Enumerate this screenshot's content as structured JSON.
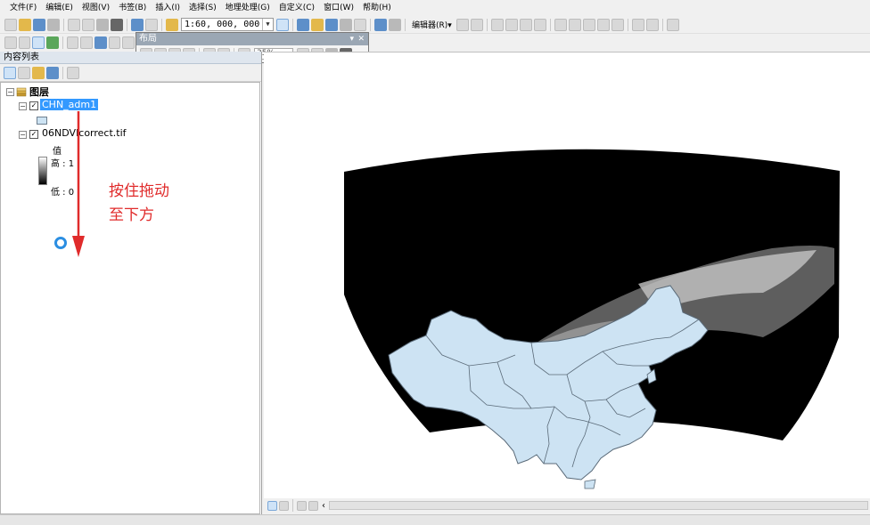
{
  "menu": {
    "items": [
      "文件(F)",
      "编辑(E)",
      "视图(V)",
      "书签(B)",
      "插入(I)",
      "选择(S)",
      "地理处理(G)",
      "自定义(C)",
      "窗口(W)",
      "帮助(H)"
    ]
  },
  "toolbar": {
    "scale": "1:60, 000, 000",
    "editor_label": "编辑器(R)▾"
  },
  "layout_window": {
    "title": "布局",
    "zoom": "35%"
  },
  "toc": {
    "title": "内容列表",
    "root_label": "图层",
    "layers": [
      {
        "name": "CHN_adm1",
        "checked": true,
        "selected": true
      },
      {
        "name": "06NDVIcorrect.tif",
        "checked": true,
        "selected": false
      }
    ],
    "legend": {
      "heading": "值",
      "high": "高 : 1",
      "low": "低 : 0"
    }
  },
  "annotation": {
    "line1": "按住拖动",
    "line2": "至下方",
    "color": "#e02b2b"
  },
  "colors": {
    "raster_black": "#000000",
    "china_fill": "#cde3f3",
    "china_outline": "#5a6a78",
    "selection": "#3399ff",
    "cursor": "#2b8ee2"
  }
}
